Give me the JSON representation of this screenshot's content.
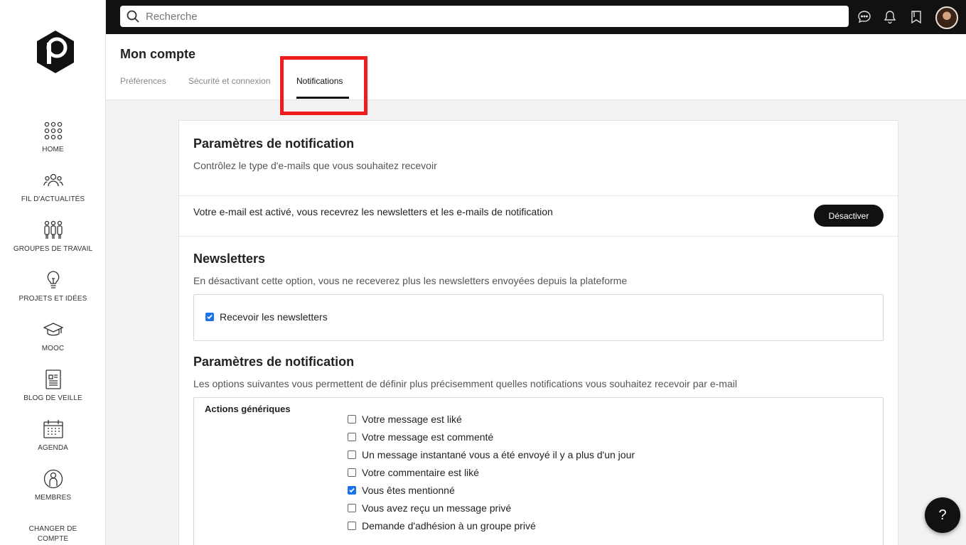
{
  "sidebar": {
    "logo_icon": "hexagon-p-logo",
    "items": [
      {
        "label": "HOME",
        "icon": "grid-dots-icon"
      },
      {
        "label": "FIL D'ACTUALITÉS",
        "icon": "people-group-icon"
      },
      {
        "label": "GROUPES DE TRAVAIL",
        "icon": "team-icon"
      },
      {
        "label": "PROJETS ET IDÉES",
        "icon": "lightbulb-icon"
      },
      {
        "label": "MOOC",
        "icon": "graduation-cap-icon"
      },
      {
        "label": "BLOG DE VEILLE",
        "icon": "document-icon"
      },
      {
        "label": "AGENDA",
        "icon": "calendar-icon"
      },
      {
        "label": "MEMBRES",
        "icon": "user-circle-icon"
      }
    ],
    "switch_account": "CHANGER DE COMPTE UTILISATEUR"
  },
  "topbar": {
    "search_placeholder": "Recherche",
    "icons": [
      "chat-icon",
      "bell-icon",
      "bookmark-icon",
      "avatar"
    ]
  },
  "header": {
    "title": "Mon compte",
    "tabs": [
      {
        "label": "Préférences",
        "active": false
      },
      {
        "label": "Sécurité et connexion",
        "active": false
      },
      {
        "label": "Notifications",
        "active": true
      }
    ]
  },
  "card": {
    "title": "Paramètres de notification",
    "subtitle": "Contrôlez le type d'e-mails que vous souhaitez recevoir",
    "status_text": "Votre e-mail est activé, vous recevrez les newsletters et les e-mails de notification",
    "deactivate_label": "Désactiver",
    "newsletters": {
      "title": "Newsletters",
      "description": "En désactivant cette option, vous ne receverez plus les newsletters envoyées depuis la plateforme",
      "checkbox_label": "Recevoir les newsletters",
      "checked": true
    },
    "notification_settings": {
      "title": "Paramètres de notification",
      "description": "Les options suivantes vous permettent de définir plus précisemment quelles notifications vous souhaitez recevoir par e-mail",
      "group_label": "Actions génériques",
      "options": [
        {
          "label": "Votre message est liké",
          "checked": false
        },
        {
          "label": "Votre message est commenté",
          "checked": false
        },
        {
          "label": "Un message instantané vous a été envoyé il y a plus d'un jour",
          "checked": false
        },
        {
          "label": "Votre commentaire est liké",
          "checked": false
        },
        {
          "label": "Vous êtes mentionné",
          "checked": true
        },
        {
          "label": "Vous avez reçu un message privé",
          "checked": false
        },
        {
          "label": "Demande d'adhésion à un groupe privé",
          "checked": false
        }
      ]
    }
  },
  "help": {
    "label": "?"
  },
  "colors": {
    "accent": "#111111",
    "highlight": "#ee1c1c",
    "checkbox": "#1a73e8"
  }
}
